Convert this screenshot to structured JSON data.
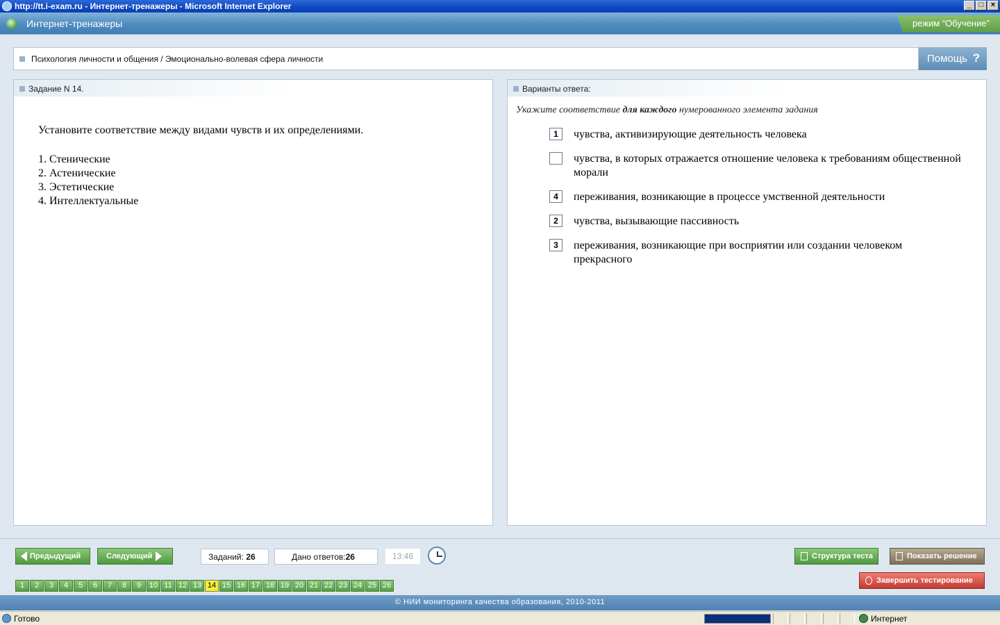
{
  "window": {
    "title": "http://tt.i-exam.ru - Интернет-тренажеры - Microsoft Internet Explorer"
  },
  "app": {
    "title": "Интернет-тренажеры",
    "mode": "режим “Обучение”"
  },
  "breadcrumb": "Психология личности и общения / Эмоционально-волевая сфера личности",
  "help_label": "Помощь",
  "task": {
    "header": "Задание N 14.",
    "question": "Установите соответствие между видами чувств и их определениями.",
    "items": [
      "1. Стенические",
      "2. Астенические",
      "3. Эстетические",
      "4. Интеллектуальные"
    ]
  },
  "answers": {
    "header": "Варианты ответа:",
    "instruction_prefix": "Укажите соответствие",
    "instruction_bold": "для каждого",
    "instruction_suffix": "нумерованного элемента задания",
    "options": [
      {
        "value": "1",
        "text": "чувства, активизирующие деятельность человека"
      },
      {
        "value": "",
        "text": "чувства, в которых отражается отношение человека к требованиям общественной морали"
      },
      {
        "value": "4",
        "text": "переживания, возникающие в процессе умственной деятельности"
      },
      {
        "value": "2",
        "text": "чувства, вызывающие пассивность"
      },
      {
        "value": "3",
        "text": "переживания, возникающие при восприятии или создании человеком прекрасного"
      }
    ]
  },
  "nav": {
    "prev": "Предыдущий",
    "next": "Следующий",
    "tasks_label": "Заданий:",
    "tasks_value": "26",
    "answers_label": "Дано ответов:",
    "answers_value": "26",
    "timer": "13:46",
    "structure": "Структура теста",
    "show_solution": "Показать решение",
    "finish": "Завершить тестирование",
    "pages": [
      "1",
      "2",
      "3",
      "4",
      "5",
      "6",
      "7",
      "8",
      "9",
      "10",
      "11",
      "12",
      "13",
      "14",
      "15",
      "16",
      "17",
      "18",
      "19",
      "20",
      "21",
      "22",
      "23",
      "24",
      "25",
      "26"
    ],
    "current_page": "14"
  },
  "footer": "© НИИ мониторинга качества образования, 2010-2011",
  "status": {
    "text": "Готово",
    "zone": "Интернет"
  },
  "window_buttons": [
    "_",
    "□",
    "×"
  ]
}
